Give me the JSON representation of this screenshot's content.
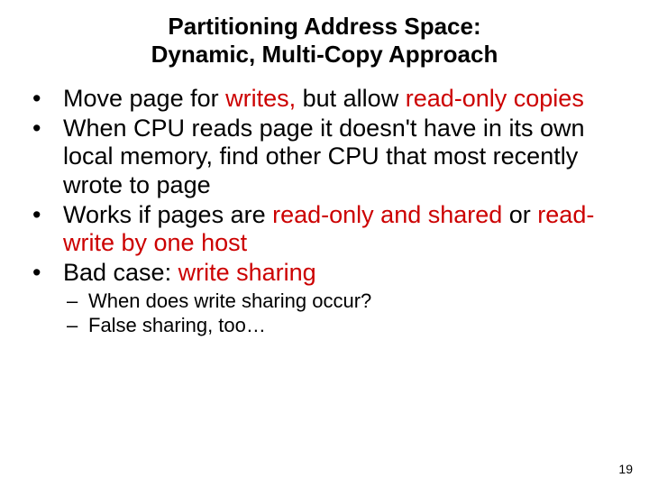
{
  "title_line1": "Partitioning Address Space:",
  "title_line2": "Dynamic, Multi-Copy Approach",
  "bullets": {
    "b1_a": "Move page for ",
    "b1_b": "writes,",
    "b1_c": " but allow ",
    "b1_d": "read-only copies",
    "b2": "When CPU reads page it doesn't have in its own local memory, find other CPU that most recently wrote to page",
    "b3_a": "Works if pages are ",
    "b3_b": "read-only and shared",
    "b3_c": " or ",
    "b3_d": "read-write by one host",
    "b4_a": "Bad case: ",
    "b4_b": "write sharing"
  },
  "sub": {
    "s1": "When does write sharing occur?",
    "s2": "False sharing, too…"
  },
  "page_number": "19"
}
